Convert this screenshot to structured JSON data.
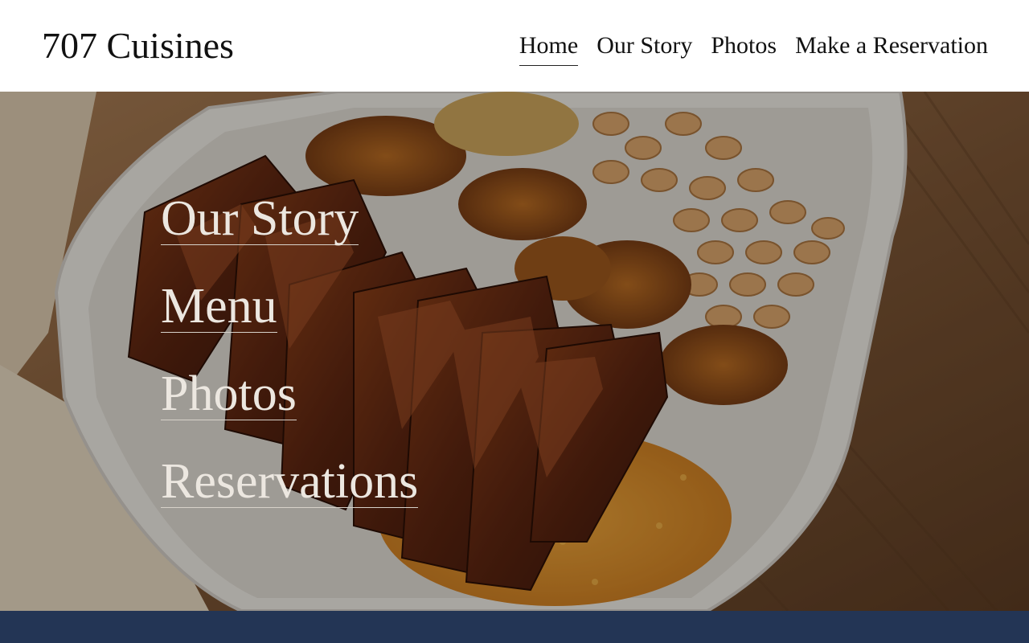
{
  "site": {
    "title": "707 Cuisines"
  },
  "nav": {
    "items": [
      {
        "label": "Home",
        "active": true
      },
      {
        "label": "Our Story",
        "active": false
      },
      {
        "label": "Photos",
        "active": false
      },
      {
        "label": "Make a Reservation",
        "active": false
      }
    ]
  },
  "hero": {
    "links": [
      {
        "label": "Our Story"
      },
      {
        "label": "Menu"
      },
      {
        "label": "Photos"
      },
      {
        "label": "Reservations"
      }
    ]
  },
  "colors": {
    "footer_band": "#233555",
    "hero_text": "#ece7e0"
  }
}
